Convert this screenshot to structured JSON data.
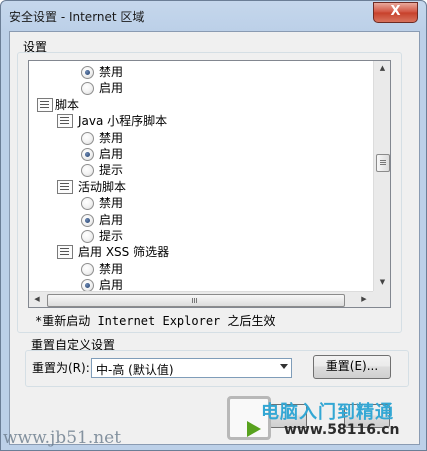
{
  "window": {
    "title": "安全设置 - Internet 区域",
    "close_label": "X"
  },
  "settings": {
    "group_label": "设置",
    "items": [
      {
        "type": "radio",
        "label": "禁用",
        "checked": true
      },
      {
        "type": "radio",
        "label": "启用",
        "checked": false
      },
      {
        "type": "category",
        "label": "脚本"
      },
      {
        "type": "subcategory",
        "label": "Java 小程序脚本"
      },
      {
        "type": "radio",
        "label": "禁用",
        "checked": false
      },
      {
        "type": "radio",
        "label": "启用",
        "checked": true
      },
      {
        "type": "radio",
        "label": "提示",
        "checked": false
      },
      {
        "type": "subcategory",
        "label": "活动脚本"
      },
      {
        "type": "radio",
        "label": "禁用",
        "checked": false
      },
      {
        "type": "radio",
        "label": "启用",
        "checked": true
      },
      {
        "type": "radio",
        "label": "提示",
        "checked": false
      },
      {
        "type": "subcategory",
        "label": "启用 XSS 筛选器"
      },
      {
        "type": "radio",
        "label": "禁用",
        "checked": false
      },
      {
        "type": "radio",
        "label": "启用",
        "checked": true
      }
    ],
    "restart_note": "*重新启动 Internet Explorer 之后生效"
  },
  "reset": {
    "group_label": "重置自定义设置",
    "reset_to_label": "重置为(R):",
    "selected_value": "中-高 (默认值)",
    "reset_button": "重置(E)..."
  },
  "watermarks": {
    "left_text": "www.jb51.net",
    "right_title": "电脑入门到精通",
    "right_url": "www.58116.cn"
  },
  "colors": {
    "accent_radio": "#1d3c6b",
    "close_button": "#c7402a",
    "watermark_blue": "#33a7d4"
  }
}
